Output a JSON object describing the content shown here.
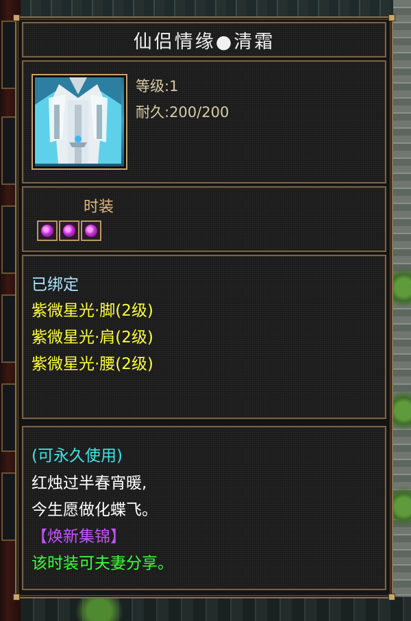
{
  "item": {
    "title": "仙侣情缘●清霜",
    "level_label": "等级:1",
    "durability_label": "耐久:200/200",
    "type_label": "时装",
    "icon": "white-blue-robe-costume-icon",
    "sockets": [
      {
        "icon": "purple-gem-icon"
      },
      {
        "icon": "purple-gem-icon"
      },
      {
        "icon": "purple-gem-icon"
      }
    ]
  },
  "attributes": {
    "bound": {
      "text": "已绑定",
      "color": "#a9e6ff"
    },
    "lines": [
      {
        "text": "紫微星光·脚(2级)",
        "color": "#ffff3c"
      },
      {
        "text": "紫微星光·肩(2级)",
        "color": "#ffff3c"
      },
      {
        "text": "紫微星光·腰(2级)",
        "color": "#ffff3c"
      }
    ]
  },
  "description": {
    "usage": {
      "text": "(可永久使用)",
      "color": "#3ce6e6"
    },
    "poem_line1": {
      "text": "红烛过半春宵暖,",
      "color": "#ffffff"
    },
    "poem_line2": {
      "text": "今生愿做化蝶飞。",
      "color": "#ffffff"
    },
    "series": {
      "text": "【焕新集锦】",
      "color": "#c455ff"
    },
    "share": {
      "text": "该时装可夫妻分享。",
      "color": "#3cff3c"
    }
  }
}
